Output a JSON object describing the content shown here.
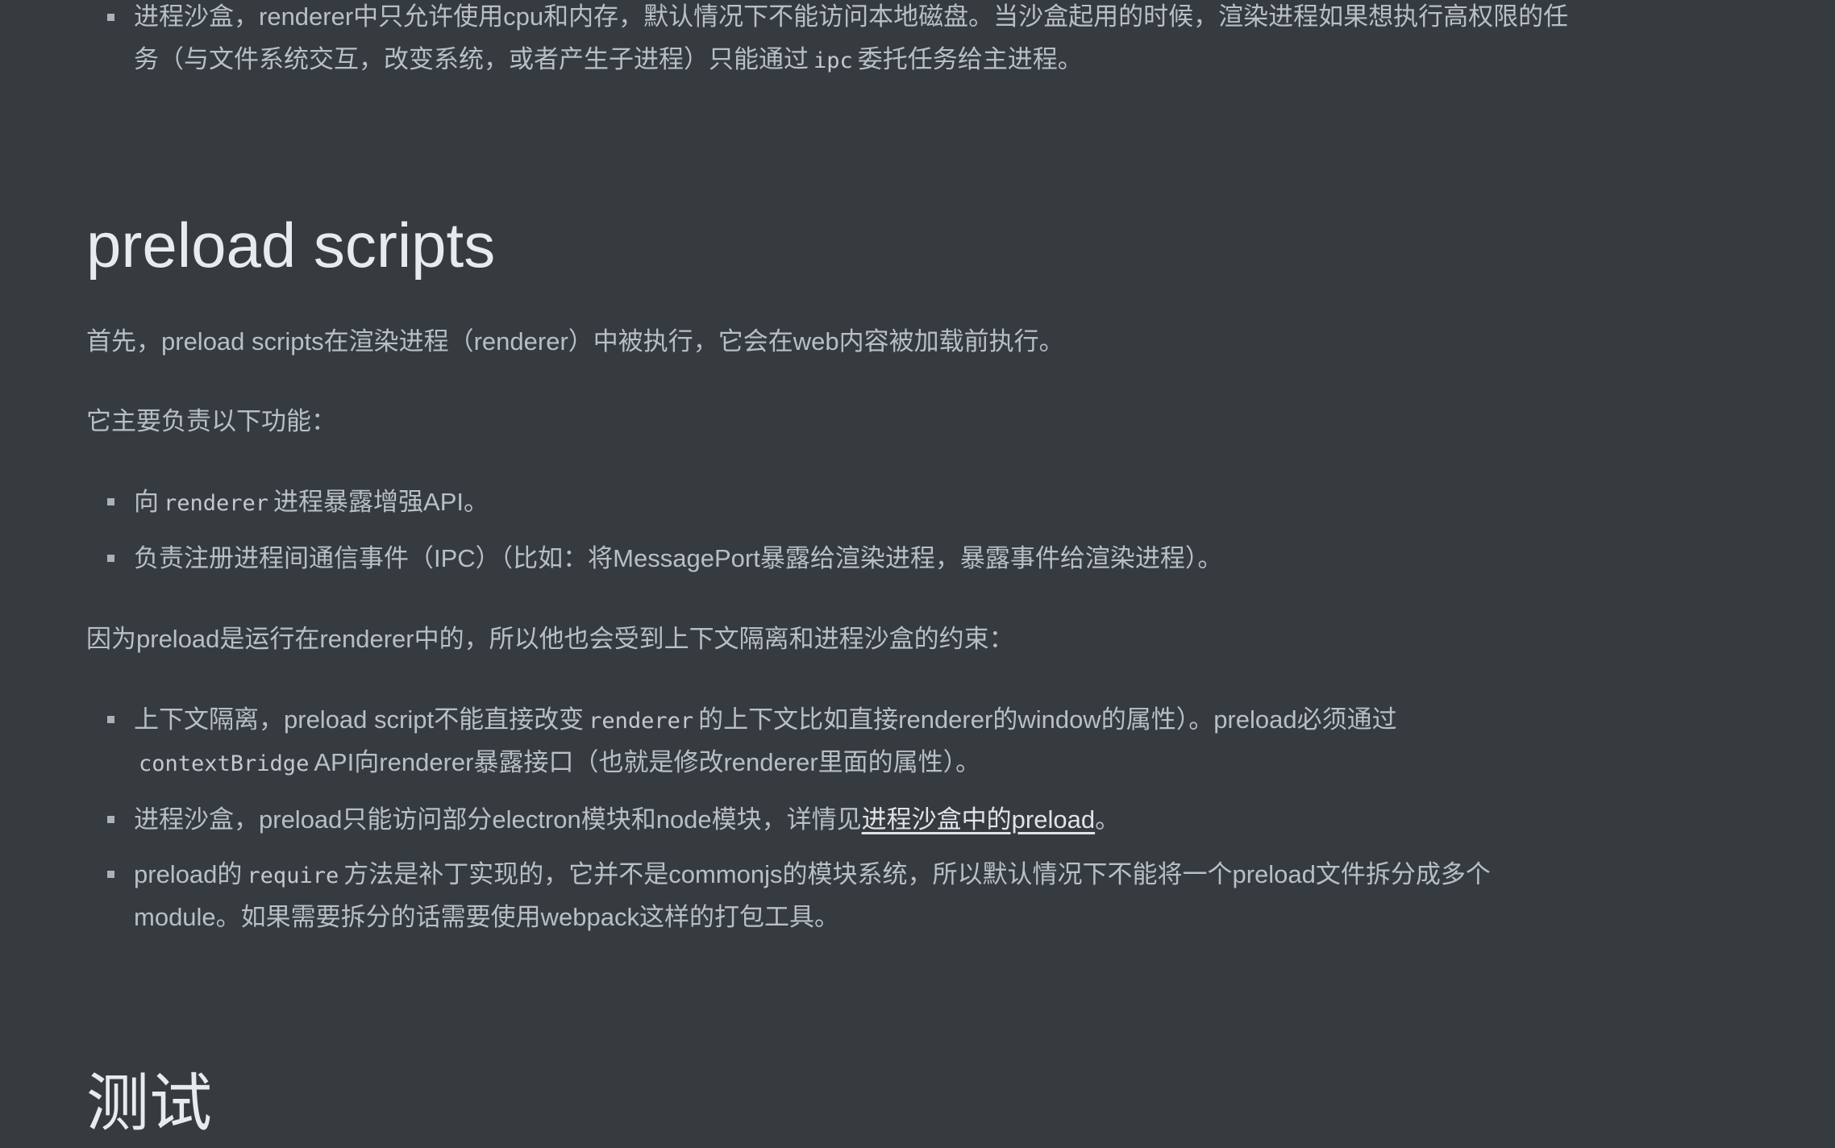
{
  "top_bullet": {
    "line1": "进程沙盒，renderer中只允许使用cpu和内存，默认情况下不能访问本地磁盘。当沙盒起用的时候，渲染进程如果想执行高权限的任",
    "line2_a": "务（与文件系统交互，改变系统，或者产生子进程）只能通过",
    "line2_code": "ipc",
    "line2_b": "委托任务给主进程。"
  },
  "section_preload": {
    "heading": "preload scripts",
    "intro": "首先，preload scripts在渲染进程（renderer）中被执行，它会在web内容被加载前执行。",
    "responsibilities_intro": "它主要负责以下功能：",
    "bullet1_a": "向",
    "bullet1_code": "renderer",
    "bullet1_b": "进程暴露增强API。",
    "bullet2": "负责注册进程间通信事件（IPC）（比如：将MessagePort暴露给渲染进程，暴露事件给渲染进程）。",
    "constraints_intro": "因为preload是运行在renderer中的，所以他也会受到上下文隔离和进程沙盒的约束：",
    "bullet3_a": "上下文隔离，preload script不能直接改变",
    "bullet3_code": "renderer",
    "bullet3_b": "的上下文比如直接renderer的window的属性）。preload必须通过",
    "bullet3_code2": "contextBridge",
    "bullet3_c": "API向renderer暴露接口（也就是修改renderer里面的属性）。",
    "bullet4_a": "进程沙盒，preload只能访问部分electron模块和node模块，详情见",
    "bullet4_link": "进程沙盒中的preload",
    "bullet4_b": "。",
    "bullet5_a": "preload的",
    "bullet5_code": "require",
    "bullet5_b": "方法是补丁实现的，它并不是commonjs的模块系统，所以默认情况下不能将一个preload文件拆分成多个",
    "bullet5_c": "module。如果需要拆分的话需要使用webpack这样的打包工具。"
  },
  "section_test": {
    "heading": "测试"
  },
  "colors": {
    "background": "#363b40",
    "text": "#b8bfc6",
    "heading": "#e8ebee",
    "link": "#e0e4e8"
  }
}
